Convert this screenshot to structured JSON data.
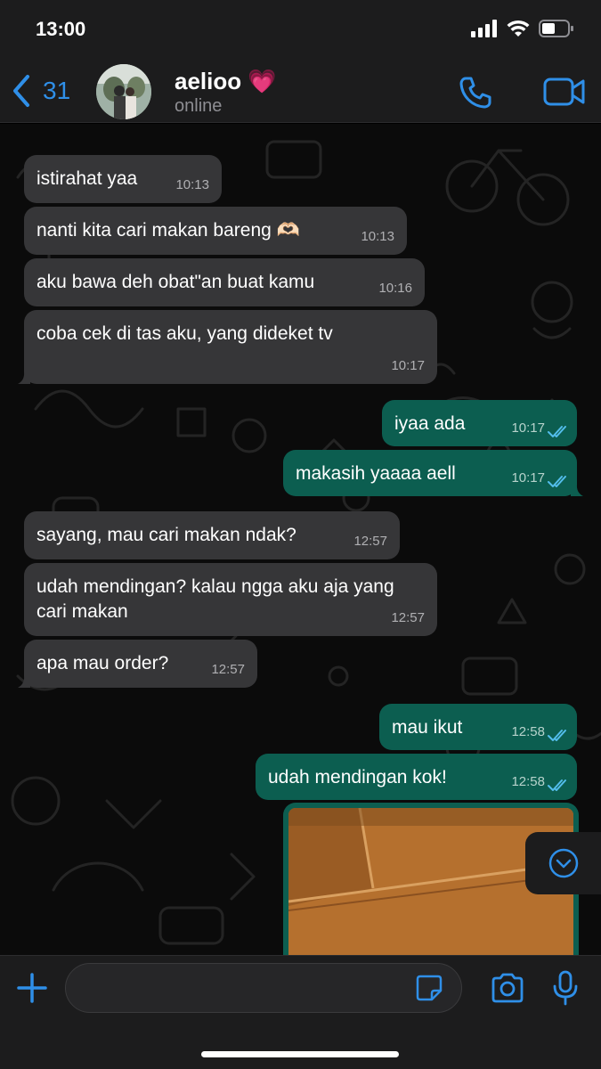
{
  "status_bar": {
    "time": "13:00"
  },
  "header": {
    "back_count": "31",
    "contact_name": "aelioo",
    "contact_emoji": "💗",
    "contact_status": "online"
  },
  "messages": [
    {
      "dir": "in",
      "text": "istirahat yaa",
      "time": "10:13"
    },
    {
      "dir": "in",
      "text": "nanti kita cari makan bareng 🫶🏻",
      "time": "10:13"
    },
    {
      "dir": "in",
      "text": "aku bawa deh obat\"an buat kamu",
      "time": "10:16"
    },
    {
      "dir": "in",
      "text": "coba cek di tas aku, yang dideket tv",
      "time": "10:17"
    },
    {
      "dir": "out",
      "text": "iyaa ada",
      "time": "10:17",
      "read": true
    },
    {
      "dir": "out",
      "text": "makasih yaaaa aell",
      "time": "10:17",
      "read": true
    },
    {
      "dir": "in",
      "text": "sayang, mau cari makan ndak?",
      "time": "12:57"
    },
    {
      "dir": "in",
      "text": "udah mendingan? kalau ngga aku aja yang cari makan",
      "time": "12:57"
    },
    {
      "dir": "in",
      "text": "apa mau order?",
      "time": "12:57"
    },
    {
      "dir": "out",
      "text": "mau ikut",
      "time": "12:58",
      "read": true
    },
    {
      "dir": "out",
      "text": "udah mendingan kok!",
      "time": "12:58",
      "read": true
    }
  ],
  "input": {
    "placeholder": "",
    "value": ""
  },
  "colors": {
    "accent": "#2f8fe8",
    "incoming_bubble": "#363638",
    "outgoing_bubble": "#0c5e50",
    "read_ticks": "#53bdeb",
    "bar_background": "#1c1c1d"
  },
  "icons": {
    "back": "chevron-left-icon",
    "call": "phone-icon",
    "video": "video-camera-icon",
    "scroll": "chevron-down-circle-icon",
    "plus": "plus-icon",
    "sticker": "sticker-icon",
    "camera": "camera-icon",
    "mic": "microphone-icon"
  }
}
